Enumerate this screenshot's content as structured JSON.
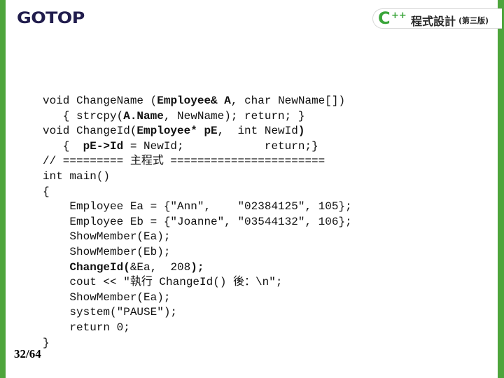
{
  "header": {
    "logo": "GOTOP",
    "badge": {
      "c": "C",
      "plus": "++",
      "title": "程式設計",
      "edition": "(第三版)"
    }
  },
  "code_lines": [
    [
      {
        "t": "void ChangeName ("
      },
      {
        "t": "Employee& A",
        "b": true
      },
      {
        "t": ", char NewName[])"
      }
    ],
    [
      {
        "t": "   { strcpy("
      },
      {
        "t": "A.Name",
        "b": true
      },
      {
        "t": ", NewName); return; }"
      }
    ],
    [
      {
        "t": "void ChangeId("
      },
      {
        "t": "Employee* pE",
        "b": true
      },
      {
        "t": ",  int NewId"
      },
      {
        "t": ")",
        "b": true
      }
    ],
    [
      {
        "t": "   {  "
      },
      {
        "t": "pE->Id",
        "b": true
      },
      {
        "t": " = NewId;            return;}"
      }
    ],
    [
      {
        "t": "// ========= 主程式 ======================="
      }
    ],
    [
      {
        "t": "int main()"
      }
    ],
    [
      {
        "t": "{"
      }
    ],
    [
      {
        "t": "    Employee Ea = {\"Ann\",    \"02384125\", 105};"
      }
    ],
    [
      {
        "t": "    Employee Eb = {\"Joanne\", \"03544132\", 106};"
      }
    ],
    [
      {
        "t": "    ShowMember(Ea);"
      }
    ],
    [
      {
        "t": "    ShowMember(Eb);"
      }
    ],
    [
      {
        "t": "    "
      },
      {
        "t": "ChangeId(",
        "b": true
      },
      {
        "t": "&Ea,  208"
      },
      {
        "t": ");",
        "b": true
      }
    ],
    [
      {
        "t": "    cout << \"執行 ChangeId() 後：\\n\";"
      }
    ],
    [
      {
        "t": "    ShowMember(Ea);"
      }
    ],
    [
      {
        "t": "    system(\"PAUSE\");"
      }
    ],
    [
      {
        "t": "    return 0;"
      }
    ],
    [
      {
        "t": "}"
      }
    ]
  ],
  "footer": {
    "page_number": "32/64"
  },
  "colors": {
    "accent_green": "#4ea53c",
    "logo_navy": "#211d4d"
  }
}
